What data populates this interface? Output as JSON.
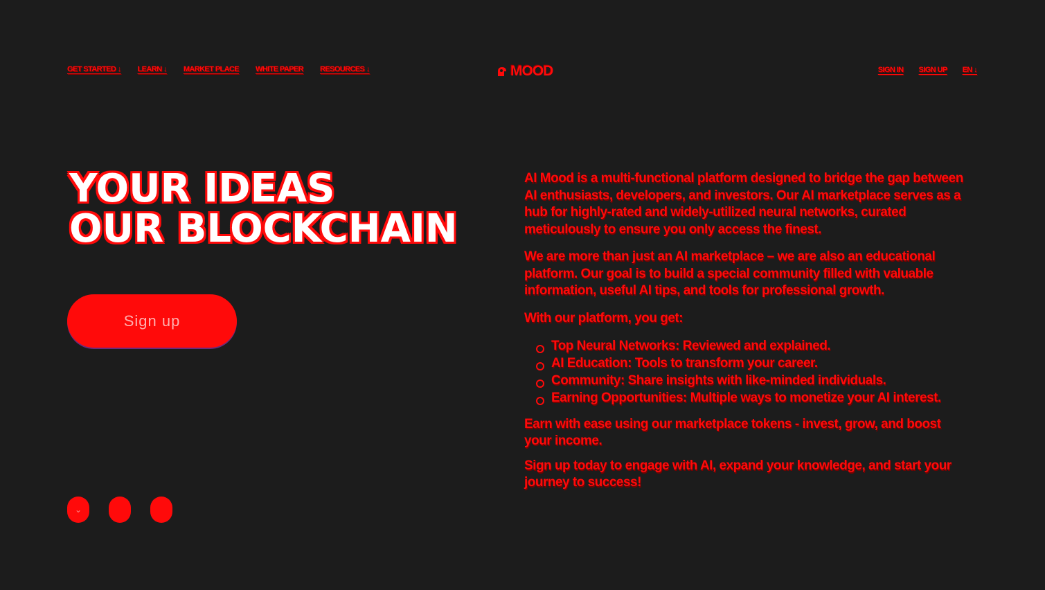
{
  "header": {
    "nav_left": [
      {
        "label": "GET STARTED ↓"
      },
      {
        "label": "LEARN ↓"
      },
      {
        "label": "MARKET PLACE"
      },
      {
        "label": "WHITE PAPER"
      },
      {
        "label": "RESOURCES ↓"
      }
    ],
    "logo_text": "MOOD",
    "nav_right": [
      {
        "label": "SIGN IN"
      },
      {
        "label": "SIGN UP"
      },
      {
        "label": "EN ↓"
      }
    ]
  },
  "hero": {
    "title_line1": "YOUR IDEAS",
    "title_line2": "OUR BLOCKCHAIN",
    "signup_label": "Sign up",
    "dots": [
      "⌄",
      "",
      ""
    ]
  },
  "copy": {
    "intro": "AI Mood is a multi-functional platform designed to bridge the gap between AI enthusiasts, developers, and investors. Our AI marketplace serves as a hub for highly-rated and widely-utilized neural networks, curated meticulously to ensure you only access the finest.",
    "education": "We are more than just an AI marketplace – we are also an educational platform. Our goal is to build a special community filled with valuable information, useful AI tips, and tools for professional growth.",
    "lead": "With our platform, you get:",
    "features": [
      "Top Neural Networks: Reviewed and explained.",
      "AI Education: Tools to transform your career.",
      "Community: Share insights with like-minded individuals.",
      "Earning Opportunities: Multiple ways to monetize your AI interest."
    ],
    "earn": "Earn with ease using our marketplace tokens - invest, grow, and boost your income.",
    "cta": "Sign up today to engage with AI, expand your knowledge, and start your journey to success!"
  },
  "colors": {
    "background": "#1c1c1c",
    "accent": "#ff0a0a",
    "title_fill": "#ffffff"
  }
}
